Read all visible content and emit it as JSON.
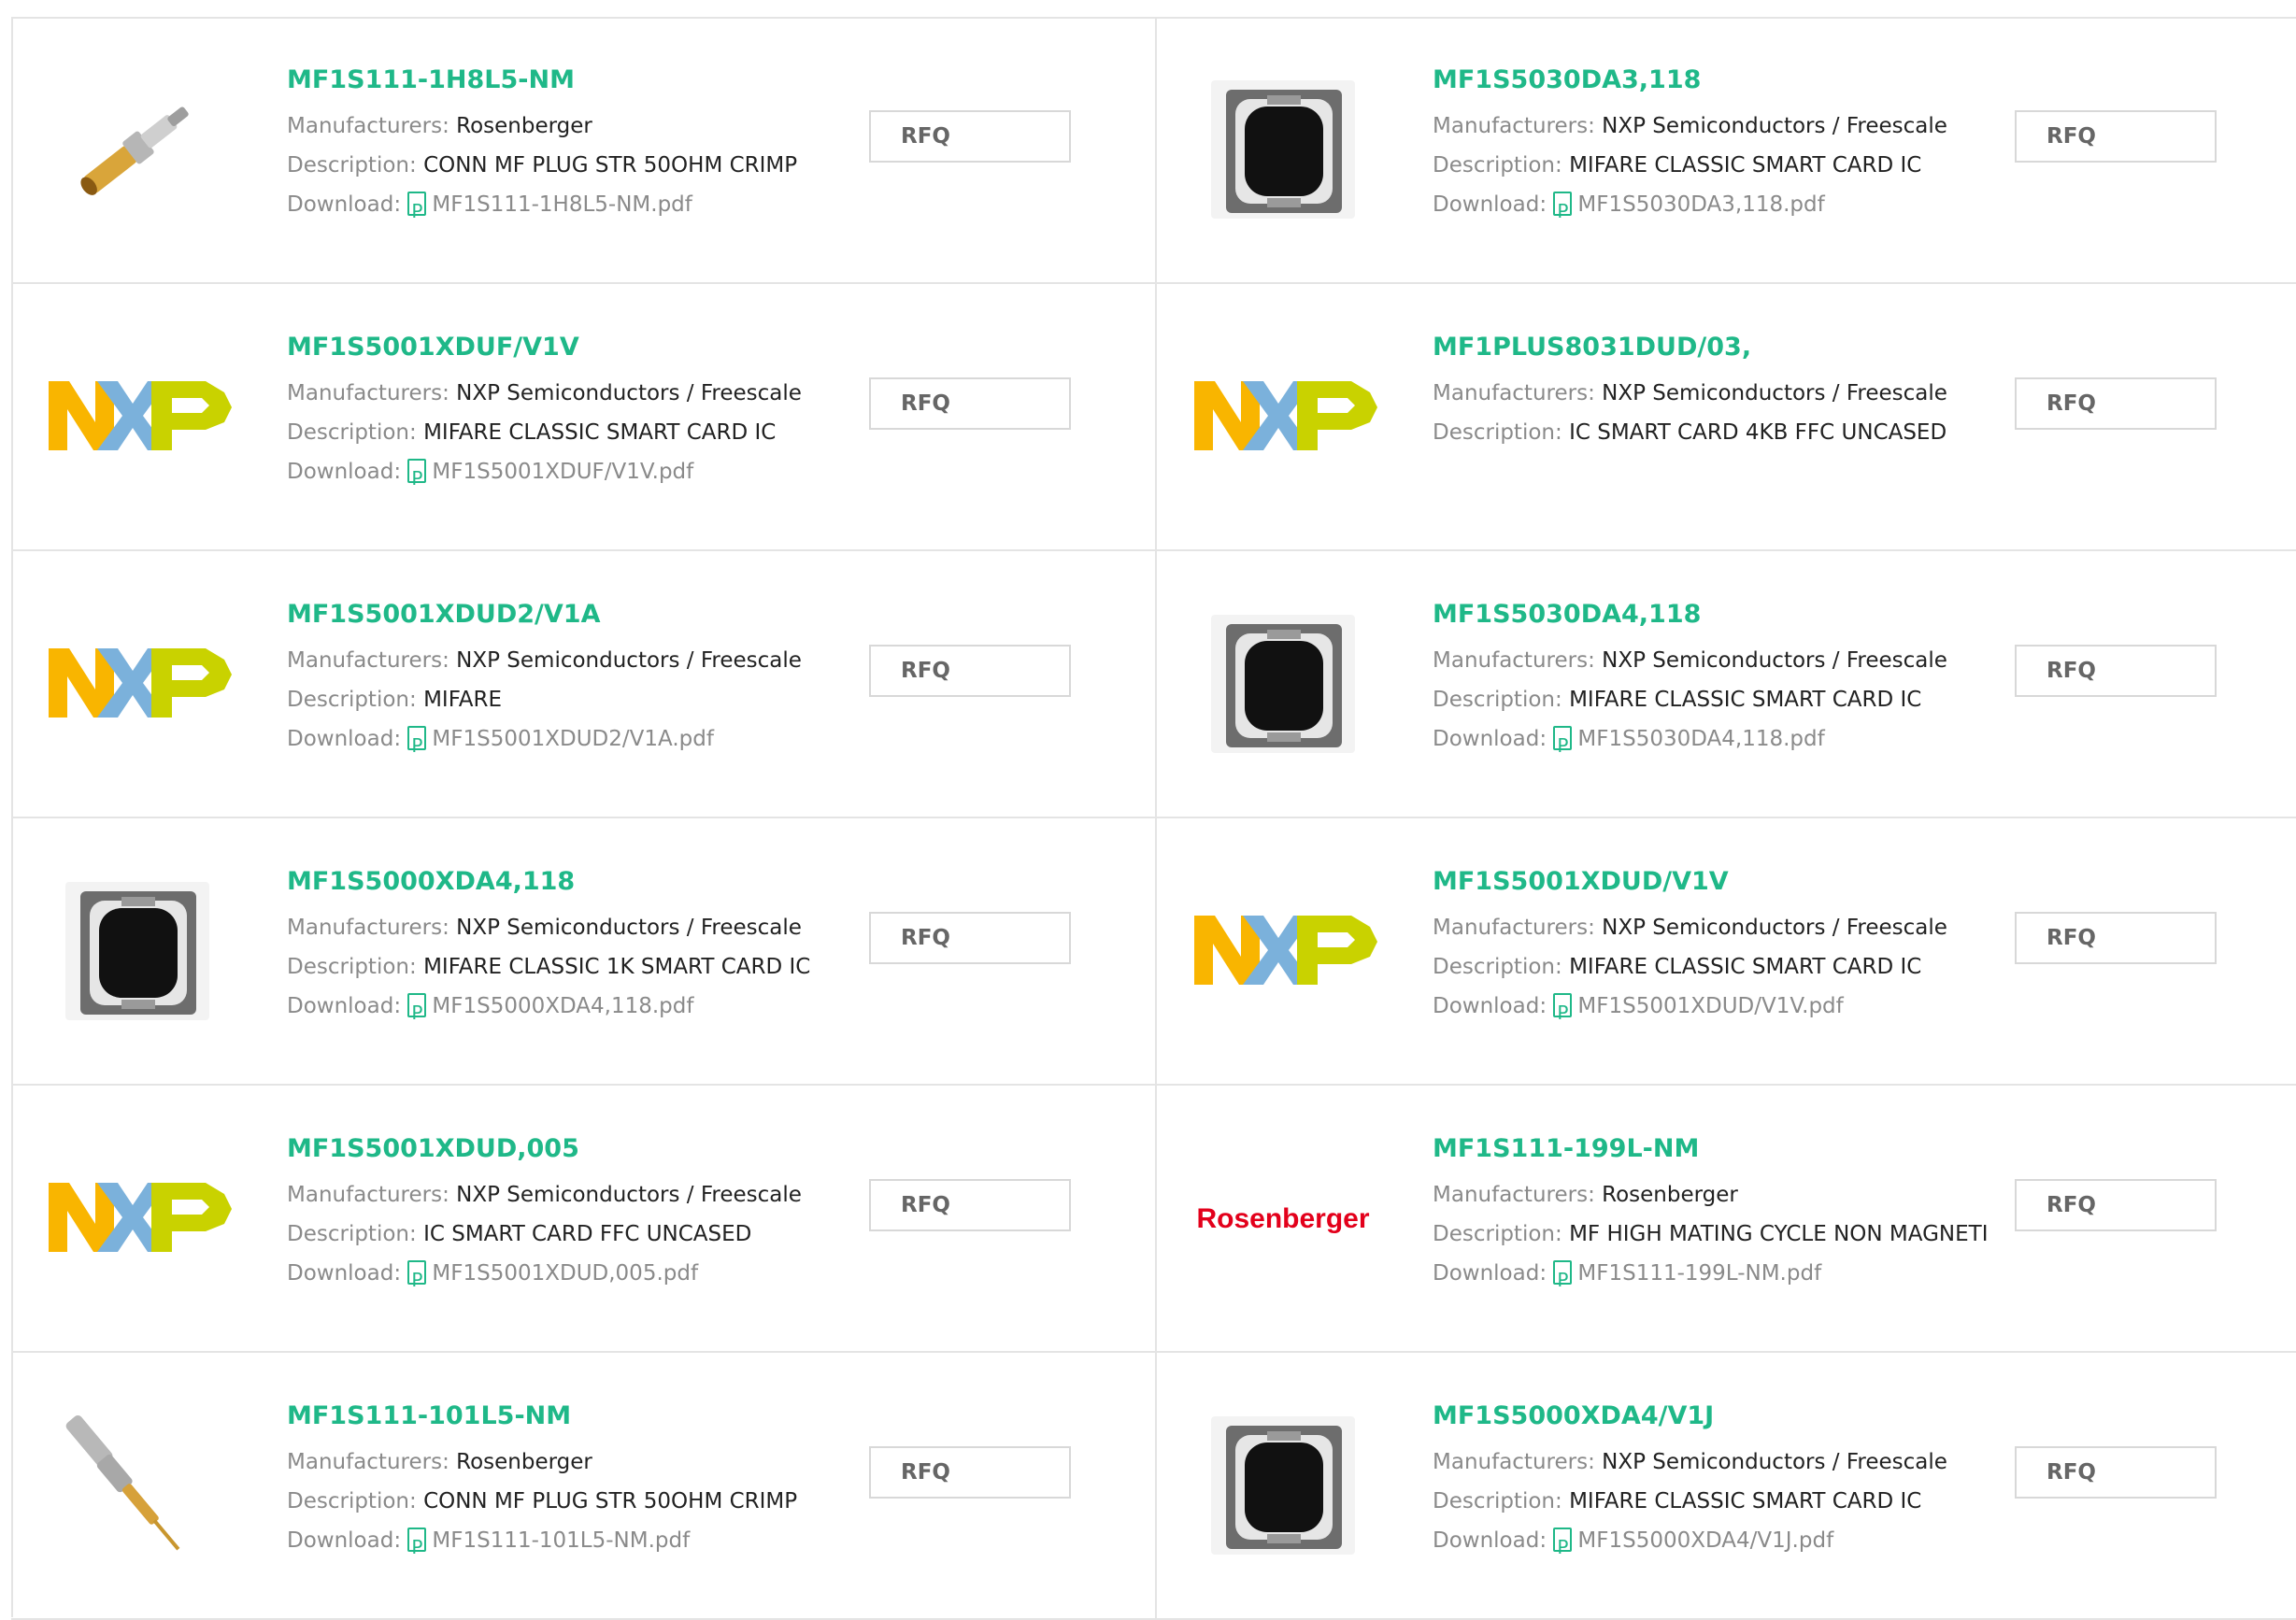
{
  "labels": {
    "manufacturers": "Manufacturers:",
    "description": "Description:",
    "download": "Download:",
    "rfq": "RFQ"
  },
  "products": [
    {
      "part": "MF1S111-1H8L5-NM",
      "manufacturer": "Rosenberger",
      "description": "CONN MF PLUG STR 50OHM CRIMP",
      "pdf": "MF1S111-1H8L5-NM.pdf",
      "image": "gold-connector-image"
    },
    {
      "part": "MF1S5030DA3,118",
      "manufacturer": "NXP Semiconductors / Freescale",
      "description": "MIFARE CLASSIC SMART CARD IC",
      "pdf": "MF1S5030DA3,118.pdf",
      "image": "chip-module-image"
    },
    {
      "part": "MF1S5001XDUF/V1V",
      "manufacturer": "NXP Semiconductors / Freescale",
      "description": "MIFARE CLASSIC SMART CARD IC",
      "pdf": "MF1S5001XDUF/V1V.pdf",
      "image": "nxp-logo"
    },
    {
      "part": "MF1PLUS8031DUD/03,",
      "manufacturer": "NXP Semiconductors / Freescale",
      "description": "IC SMART CARD 4KB FFC UNCASED",
      "pdf": "",
      "image": "nxp-logo"
    },
    {
      "part": "MF1S5001XDUD2/V1A",
      "manufacturer": "NXP Semiconductors / Freescale",
      "description": "MIFARE",
      "pdf": "MF1S5001XDUD2/V1A.pdf",
      "image": "nxp-logo"
    },
    {
      "part": "MF1S5030DA4,118",
      "manufacturer": "NXP Semiconductors / Freescale",
      "description": "MIFARE CLASSIC SMART CARD IC",
      "pdf": "MF1S5030DA4,118.pdf",
      "image": "chip-module-image"
    },
    {
      "part": "MF1S5000XDA4,118",
      "manufacturer": "NXP Semiconductors / Freescale",
      "description": "MIFARE CLASSIC 1K SMART CARD IC",
      "pdf": "MF1S5000XDA4,118.pdf",
      "image": "chip-module-image"
    },
    {
      "part": "MF1S5001XDUD/V1V",
      "manufacturer": "NXP Semiconductors / Freescale",
      "description": "MIFARE CLASSIC SMART CARD IC",
      "pdf": "MF1S5001XDUD/V1V.pdf",
      "image": "nxp-logo"
    },
    {
      "part": "MF1S5001XDUD,005",
      "manufacturer": "NXP Semiconductors / Freescale",
      "description": "IC SMART CARD FFC UNCASED",
      "pdf": "MF1S5001XDUD,005.pdf",
      "image": "nxp-logo"
    },
    {
      "part": "MF1S111-199L-NM",
      "manufacturer": "Rosenberger",
      "description": "MF HIGH MATING CYCLE NON MAGNETI",
      "pdf": "MF1S111-199L-NM.pdf",
      "image": "rosenberger-logo",
      "logo_text": "Rosenberger"
    },
    {
      "part": "MF1S111-101L5-NM",
      "manufacturer": "Rosenberger",
      "description": "CONN MF PLUG STR 50OHM CRIMP",
      "pdf": "MF1S111-101L5-NM.pdf",
      "image": "connector-kit-image"
    },
    {
      "part": "MF1S5000XDA4/V1J",
      "manufacturer": "NXP Semiconductors / Freescale",
      "description": "MIFARE CLASSIC SMART CARD IC",
      "pdf": "MF1S5000XDA4/V1J.pdf",
      "image": "chip-module-image"
    }
  ],
  "colors": {
    "part_link": "#1fb888",
    "label_gray": "#8a8a8a",
    "border": "#e4e4e4",
    "nxp_orange": "#f9b500",
    "nxp_blue": "#7bb1db",
    "nxp_green": "#c9d200",
    "rosenberger_red": "#e3001b"
  }
}
